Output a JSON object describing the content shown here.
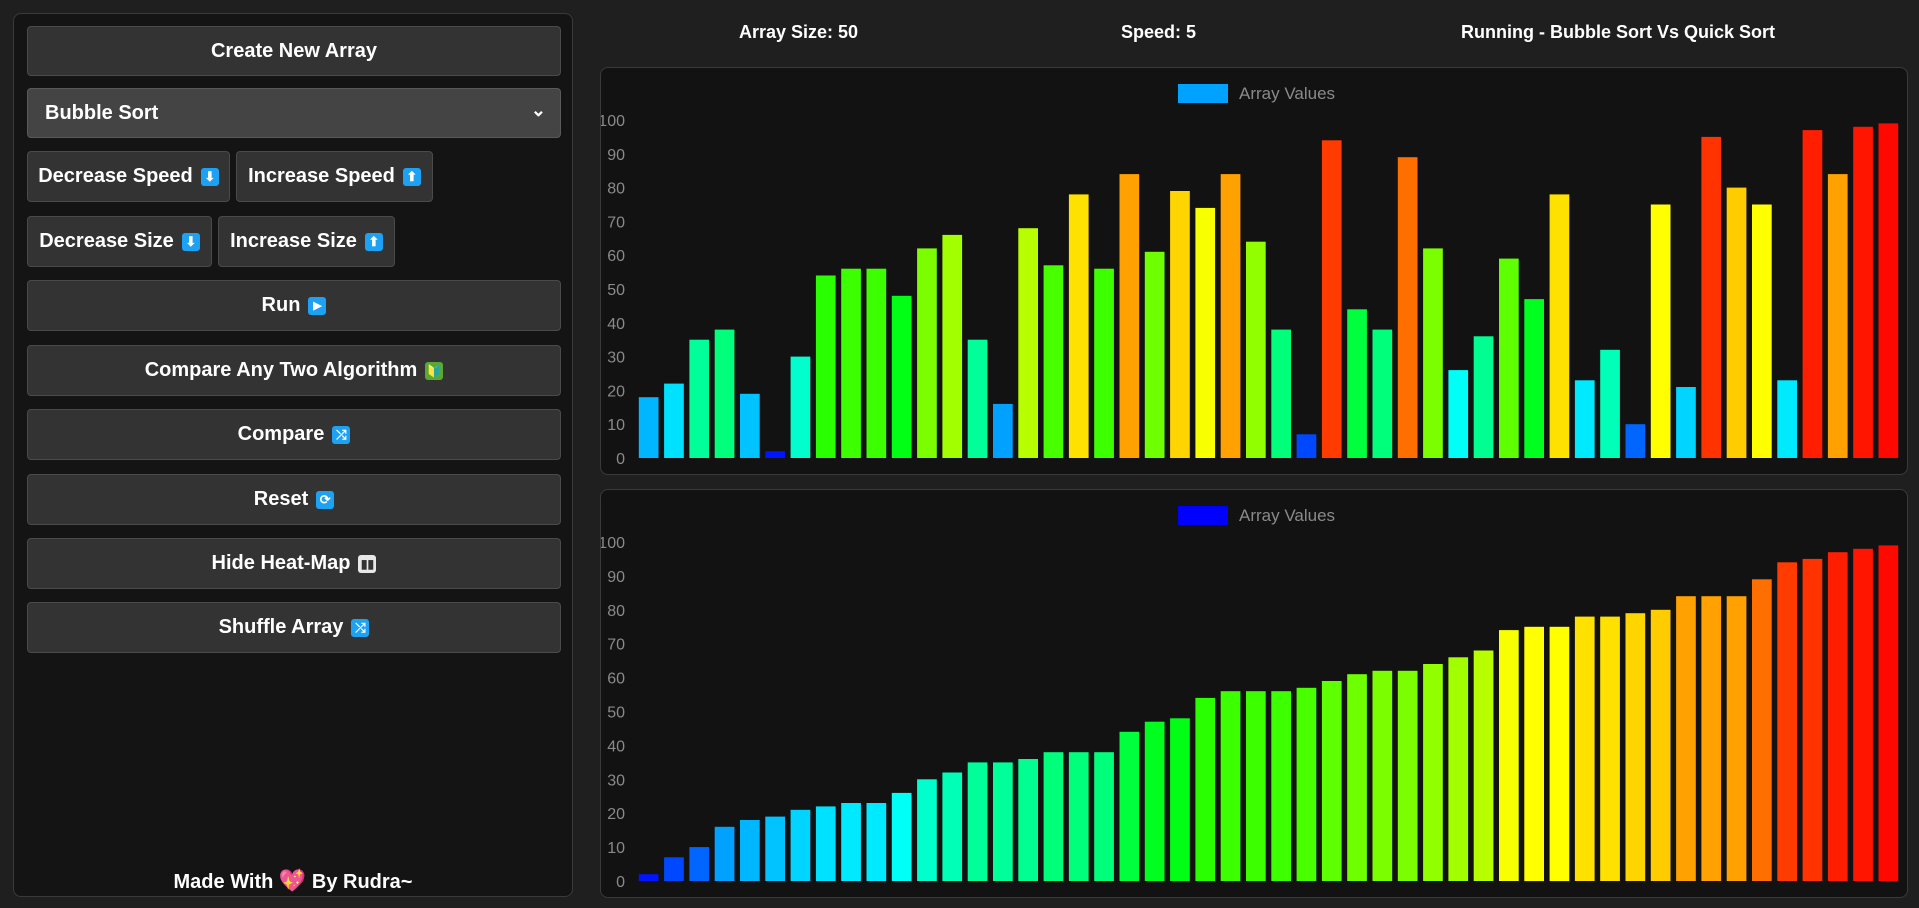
{
  "sidebar": {
    "create_label": "Create New Array",
    "algorithm_select": "Bubble Sort",
    "decrease_speed_label": "Decrease Speed",
    "increase_speed_label": "Increase Speed",
    "decrease_size_label": "Decrease Size",
    "increase_size_label": "Increase Size",
    "run_label": "Run",
    "compare_any_label": "Compare Any Two Algorithm",
    "compare_label": "Compare",
    "reset_label": "Reset",
    "heatmap_label": "Hide Heat-Map",
    "shuffle_label": "Shuffle Array",
    "footer_prefix": "Made With",
    "footer_suffix": "By Rudra~"
  },
  "icons": {
    "down_arrow": "⬇",
    "up_arrow": "⬆",
    "play": "▶",
    "beginner": "🔰",
    "shuffle": "⤮",
    "repeat": "⟳",
    "bar_chart": "▮▮",
    "heart": "💖",
    "chevron": "⌄"
  },
  "header": {
    "array_size": "Array Size: 50",
    "speed": "Speed: 5",
    "status": "Running - Bubble Sort Vs Quick Sort"
  },
  "colors": {
    "legend_top": "#00a2ff",
    "legend_bottom": "#0000ff"
  },
  "chart_data": [
    {
      "type": "bar",
      "legend": "Array Values",
      "ylim": [
        0,
        100
      ],
      "yticks": [
        0,
        10,
        20,
        30,
        40,
        50,
        60,
        70,
        80,
        90,
        100
      ],
      "values": [
        18,
        22,
        35,
        38,
        19,
        2,
        30,
        54,
        56,
        56,
        48,
        62,
        66,
        35,
        16,
        68,
        57,
        78,
        56,
        84,
        61,
        79,
        74,
        84,
        64,
        38,
        7,
        94,
        44,
        38,
        89,
        62,
        26,
        36,
        59,
        47,
        78,
        23,
        32,
        10,
        75,
        21,
        95,
        80,
        75,
        23,
        97,
        84,
        98,
        99
      ]
    },
    {
      "type": "bar",
      "legend": "Array Values",
      "ylim": [
        0,
        100
      ],
      "yticks": [
        0,
        10,
        20,
        30,
        40,
        50,
        60,
        70,
        80,
        90,
        100
      ],
      "values": [
        2,
        7,
        10,
        16,
        18,
        19,
        21,
        22,
        23,
        23,
        26,
        30,
        32,
        35,
        35,
        36,
        38,
        38,
        38,
        44,
        47,
        48,
        54,
        56,
        56,
        56,
        57,
        59,
        61,
        62,
        62,
        64,
        66,
        68,
        74,
        75,
        75,
        78,
        78,
        79,
        80,
        84,
        84,
        84,
        89,
        94,
        95,
        97,
        98,
        99
      ]
    }
  ]
}
